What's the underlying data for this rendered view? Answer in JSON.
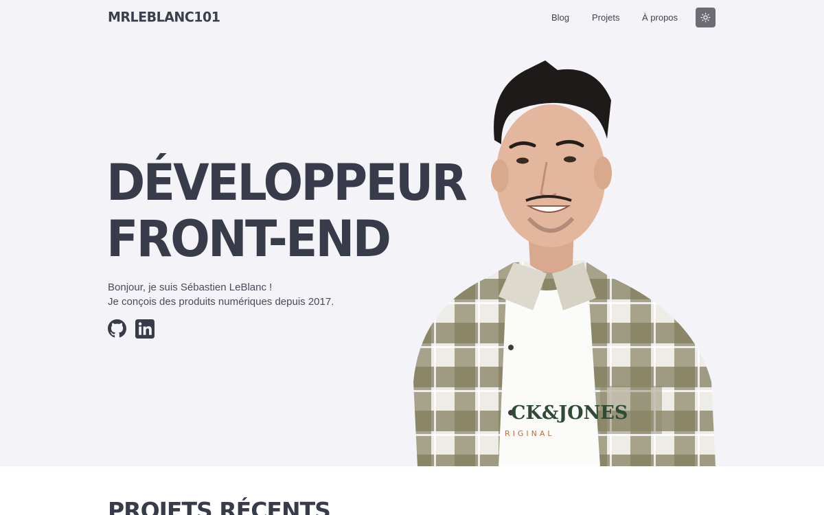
{
  "header": {
    "logo": "MRLEBLANC101",
    "nav": [
      "Blog",
      "Projets",
      "À propos"
    ],
    "theme_toggle_icon": "sun-icon"
  },
  "hero": {
    "title_line1": "DÉVELOPPEUR",
    "title_line2": "FRONT-END",
    "intro_line1": "Bonjour, je suis Sébastien LeBlanc !",
    "intro_line2": "Je conçois des produits numériques depuis 2017.",
    "social": [
      "github-icon",
      "linkedin-icon"
    ],
    "shirt_print_line1": "CK&JONES",
    "shirt_print_line2": "RIGINAL"
  },
  "sections": {
    "recent_projects_title": "PROJETS RÉCENTS"
  },
  "colors": {
    "background": "#f4f3f7",
    "text": "#3b3f4c",
    "theme_button": "#6c6c74"
  }
}
